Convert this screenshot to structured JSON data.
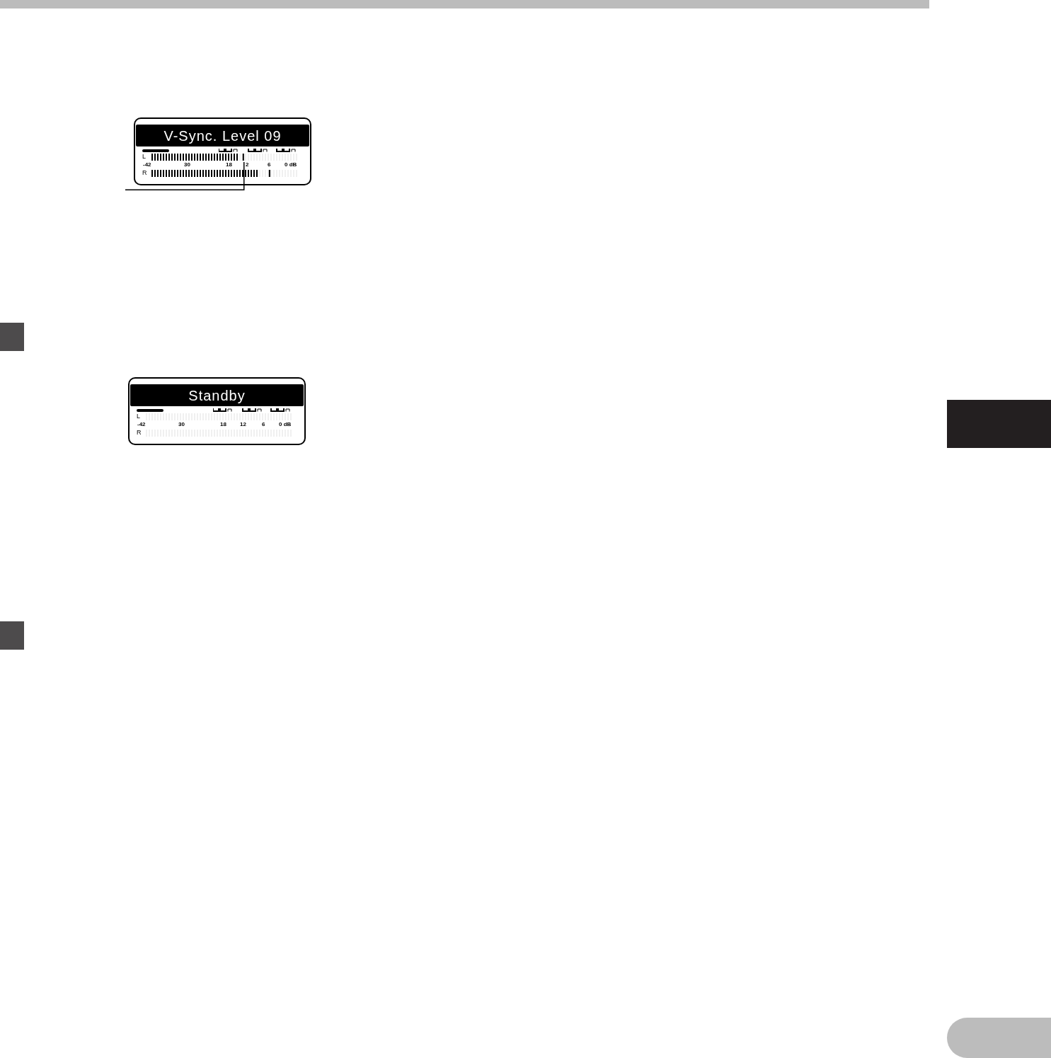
{
  "displays": [
    {
      "title": "V-Sync. Level 09",
      "meters": [
        {
          "channel": "L",
          "level": 0.6,
          "peak": {
            "level": 0.63
          }
        },
        {
          "channel": "R",
          "level": 0.72,
          "peak": {
            "level": 0.81
          }
        }
      ],
      "scale": [
        "-42",
        "30",
        "18",
        "2",
        "6",
        "0 dB"
      ]
    },
    {
      "title": "Standby",
      "meters": [
        {
          "channel": "L"
        },
        {
          "channel": "R"
        }
      ],
      "scale": [
        "-42",
        "30",
        "18",
        "12",
        "6",
        "0 dB"
      ]
    }
  ]
}
